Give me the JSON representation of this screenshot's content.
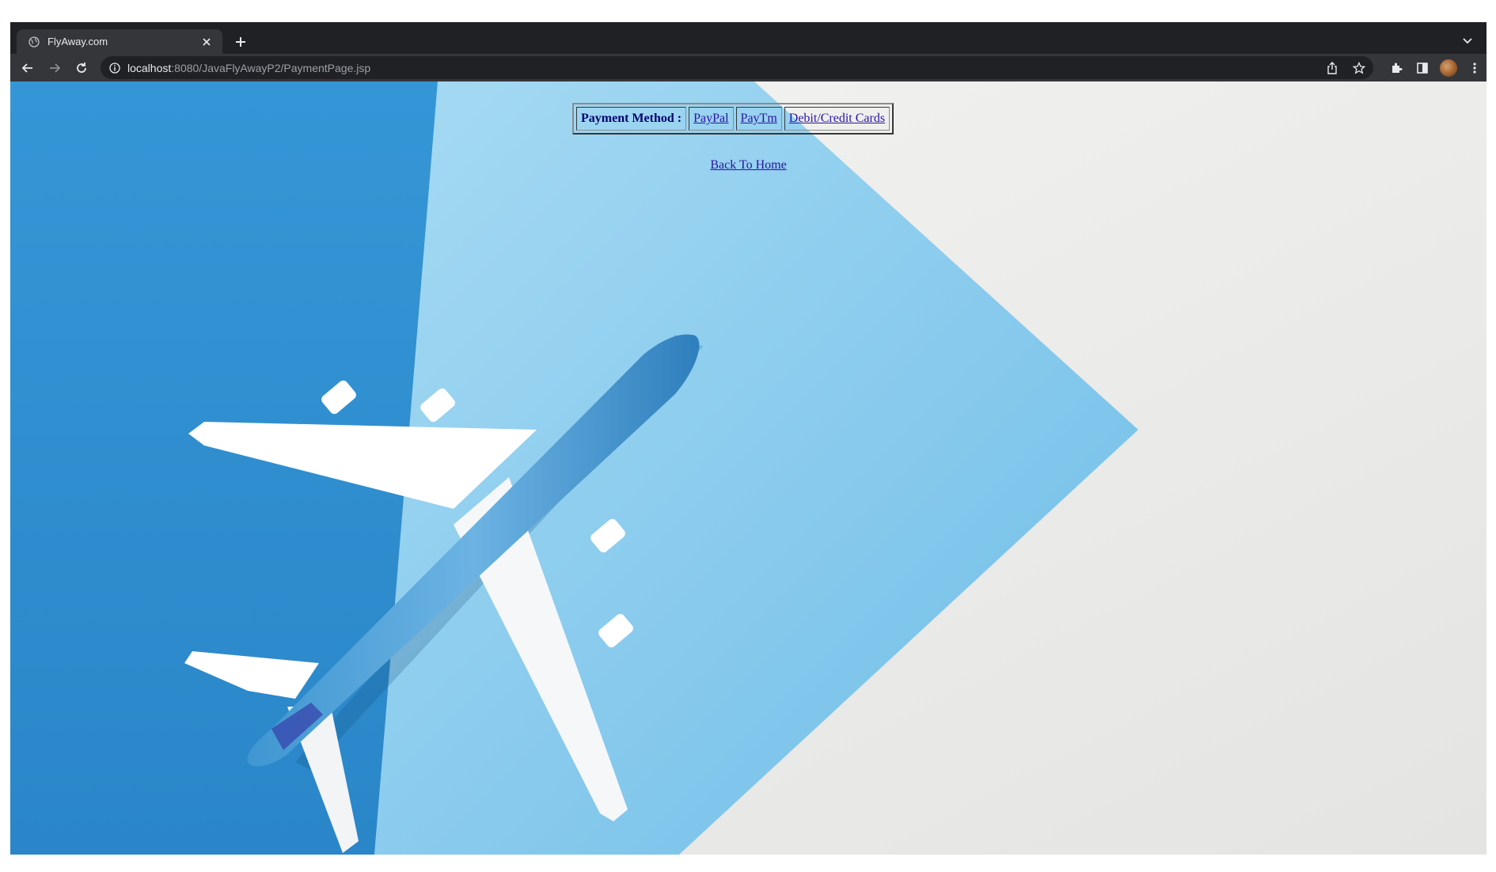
{
  "browser": {
    "tab_title": "FlyAway.com",
    "url_host": "localhost",
    "url_rest": ":8080/JavaFlyAwayP2/PaymentPage.jsp",
    "icons": [
      "globe-icon",
      "close-icon",
      "plus-icon",
      "chevron-down-icon",
      "back-arrow-icon",
      "forward-arrow-icon",
      "reload-icon",
      "info-icon",
      "share-icon",
      "star-icon",
      "extensions-icon",
      "side-panel-icon",
      "avatar",
      "kebab-menu-icon"
    ]
  },
  "page": {
    "payment_label": "Payment Method :",
    "methods": [
      "PayPal",
      "PayTm",
      "Debit/Credit Cards"
    ],
    "back_link": "Back To Home",
    "background": "airplane-photo"
  },
  "colors": {
    "link": "#2b13a3",
    "label": "#00006e",
    "sky_dark": "#2f8fd3",
    "sky_light": "#7cc3ea",
    "paper": "#ececeb"
  }
}
